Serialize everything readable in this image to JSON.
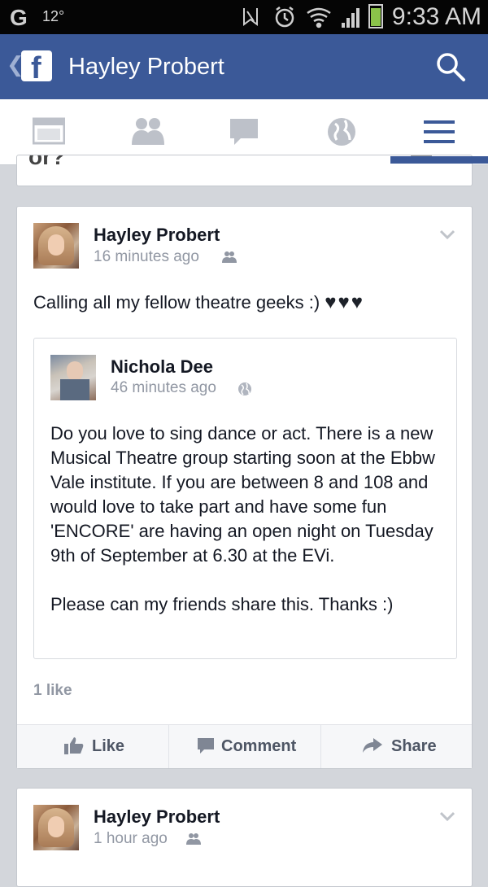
{
  "status_bar": {
    "g_label": "G",
    "temperature": "12°",
    "time": "9:33 AM"
  },
  "title_bar": {
    "back_glyph": "❮",
    "logo_letter": "f",
    "title": "Hayley Probert",
    "search_icon": "search-icon"
  },
  "tabs": [
    {
      "icon": "news-feed-icon",
      "active": false
    },
    {
      "icon": "friends-icon",
      "active": false
    },
    {
      "icon": "messages-icon",
      "active": false
    },
    {
      "icon": "notifications-globe-icon",
      "active": false
    },
    {
      "icon": "menu-icon",
      "active": true
    }
  ],
  "previous_post": {
    "fragment_text": "or?"
  },
  "post": {
    "author": "Hayley Probert",
    "time": "16 minutes ago",
    "audience_icon": "friends-audience-icon",
    "text": "Calling all my fellow theatre geeks :) ",
    "hearts": "♥♥♥",
    "shared": {
      "author": "Nichola Dee",
      "time": "46 minutes ago",
      "audience_icon": "public-globe-icon",
      "paragraph_1": "Do you love to sing dance or act. There is a new Musical Theatre group starting soon at the Ebbw Vale institute. If you are between 8 and 108 and would love to take part and have some fun 'ENCORE' are having an open night on Tuesday 9th of September at 6.30 at the EVi.",
      "paragraph_2": "Please can my friends share this.  Thanks :)"
    },
    "likes": "1 like",
    "actions": {
      "like": "Like",
      "comment": "Comment",
      "share": "Share"
    }
  },
  "next_post": {
    "author": "Hayley Probert",
    "time": "1 hour ago"
  },
  "colors": {
    "facebook_blue": "#3b5998",
    "feed_background": "#d3d6db"
  }
}
